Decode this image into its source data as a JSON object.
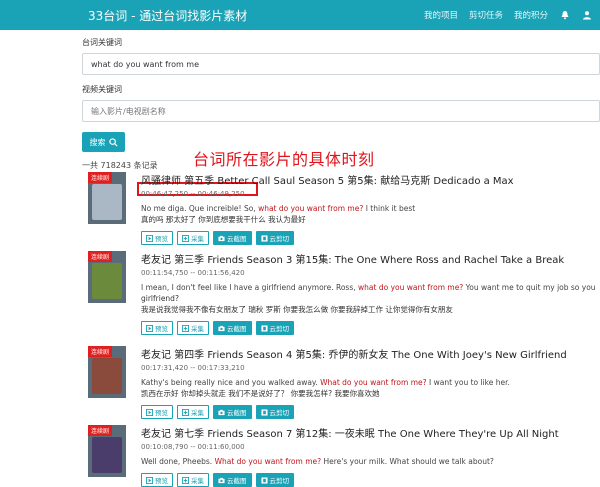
{
  "brand": {
    "title": "33台词 - 通过台词找影片素材"
  },
  "nav": {
    "my_projects": "我的项目",
    "cut_tasks": "剪切任务",
    "my_points": "我的积分"
  },
  "search": {
    "keyword_label": "台词关键词",
    "keyword_value": "what do you want from me",
    "video_label": "视频关键词",
    "video_placeholder": "输入影片/电视剧名称",
    "search_button": "搜索"
  },
  "result_count": "一共 718243 条记录",
  "annotation": "台词所在影片的具体时刻",
  "results": [
    {
      "badge": "连续剧",
      "title": "风骚律师 第五季 Better Call Saul Season 5 第5集: 献给马克斯 Dedicado a Max",
      "time": "00:46:47,250 -- 00:46:49,250",
      "line_before": "No me diga. Que increible!  So, ",
      "line_highlight": "what do you want from me?",
      "line_after": " I think it best",
      "line2_before": "真的吗 那太好了  ",
      "line2_highlight": "你到底想要我干什么",
      "line2_after": " 我认为最好",
      "art_color": "#a9b8c4"
    },
    {
      "badge": "连续剧",
      "title": "老友记 第三季 Friends Season 3 第15集: The One Where Ross and Rachel Take a Break",
      "time": "00:11:54,750 -- 00:11:56,420",
      "line_before": "I mean, I don't feel like I have a girlfriend anymore.  Ross, ",
      "line_highlight": "what do you want from me?",
      "line_after": " You want me to quit my job so you can feel like you have a",
      "line_extra": "girlfriend?",
      "line2_before": "我是说我觉得我不像有女朋友了 瑞秋  罗斯 ",
      "line2_highlight": "你要我怎么做",
      "line2_after": " 你要我辞掉工作 让你觉得你有女朋友",
      "art_color": "#6b8a3c"
    },
    {
      "badge": "连续剧",
      "title": "老友记 第四季 Friends Season 4 第5集: 乔伊的新女友 The One With Joey's New Girlfriend",
      "time": "00:17:31,420 -- 00:17:33,210",
      "line_before": "Kathy's being really nice and you walked away.  ",
      "line_highlight": "What do you want from me?",
      "line_after": " I want you to like her.",
      "line2_before": "凯西在示好 你却掉头就走 我们不是说好了？  ",
      "line2_highlight": "你要我怎样?",
      "line2_after": " 我要你喜欢她",
      "art_color": "#8a4a3c"
    },
    {
      "badge": "连续剧",
      "title": "老友记 第七季 Friends Season 7 第12集: 一夜未眠 The One Where They're Up All Night",
      "time": "00:10:08,790 -- 00:11:60,000",
      "line_before": "Well done, Pheebs.  ",
      "line_highlight": "What do you want from me?",
      "line_after": " Here's your milk. What should we talk about?",
      "line2_before": "",
      "line2_highlight": "",
      "line2_after": "",
      "art_color": "#4a3c6b"
    }
  ],
  "buttons": {
    "preview": "预览",
    "collect": "采集",
    "screenshot": "云截图",
    "cloud_cut": "云剪切"
  }
}
